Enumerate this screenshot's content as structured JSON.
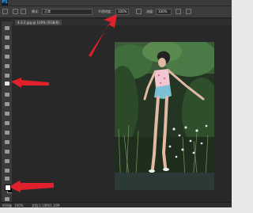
{
  "app": {
    "logo": "PS"
  },
  "options_bar": {
    "mode_label": "模式:",
    "mode_value": "正常",
    "opacity_label": "不透明度:",
    "opacity_value": "100%",
    "flow_label": "流量:",
    "flow_value": "100%"
  },
  "document": {
    "tab_title": "4-3-2.jpg @ 100% (RGB/8)"
  },
  "status_bar": {
    "zoom": "100%",
    "doc_info": "文档:1.10M/1.10M",
    "label": "时间轴"
  },
  "annotations": {
    "arrow_color": "#e0202a"
  }
}
